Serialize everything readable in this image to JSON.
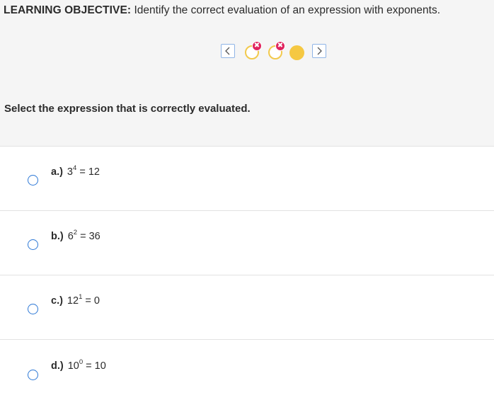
{
  "header": {
    "objective_label": "LEARNING OBJECTIVE:",
    "objective_text": " Identify the correct evaluation of an expression with exponents."
  },
  "progress_nav": {
    "prev_icon": "chevron-left-icon",
    "next_icon": "chevron-right-icon",
    "items": [
      {
        "status": "incorrect",
        "badge": "✖"
      },
      {
        "status": "incorrect",
        "badge": "✖"
      },
      {
        "status": "current"
      }
    ],
    "colors": {
      "accent_yellow": "#f5c842",
      "wrong_red": "#e0245e",
      "border_blue": "#8fb4e6"
    }
  },
  "question": {
    "prompt": "Select the expression that is correctly evaluated."
  },
  "options": [
    {
      "letter": "a.)",
      "base": "3",
      "exp": "4",
      "rest": " = 12"
    },
    {
      "letter": "b.)",
      "base": "6",
      "exp": "2",
      "rest": " = 36"
    },
    {
      "letter": "c.)",
      "base": "12",
      "exp": "1",
      "rest": " = 0"
    },
    {
      "letter": "d.)",
      "base": "10",
      "exp": "0",
      "rest": " = 10"
    }
  ],
  "radio_color": "#2d78d6"
}
